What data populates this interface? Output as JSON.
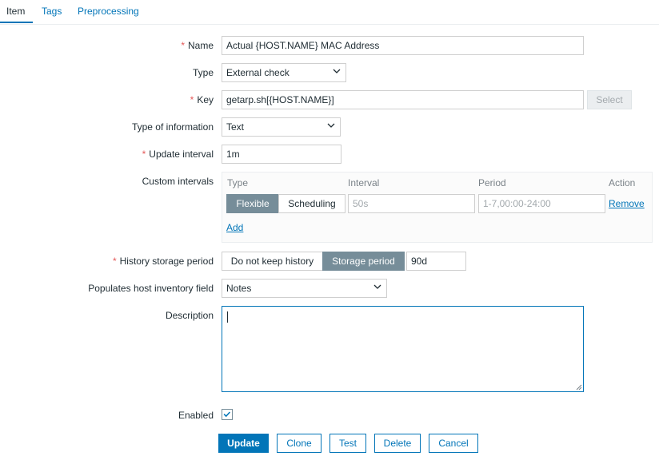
{
  "tabs": [
    {
      "label": "Item",
      "active": true
    },
    {
      "label": "Tags",
      "active": false
    },
    {
      "label": "Preprocessing",
      "active": false
    }
  ],
  "form": {
    "name": {
      "label": "Name",
      "required": true,
      "value": "Actual {HOST.NAME} MAC Address"
    },
    "type": {
      "label": "Type",
      "value": "External check"
    },
    "key": {
      "label": "Key",
      "required": true,
      "value": "getarp.sh[{HOST.NAME}]",
      "select_label": "Select"
    },
    "type_of_information": {
      "label": "Type of information",
      "value": "Text"
    },
    "update_interval": {
      "label": "Update interval",
      "required": true,
      "value": "1m"
    },
    "custom_intervals": {
      "label": "Custom intervals",
      "headers": {
        "type": "Type",
        "interval": "Interval",
        "period": "Period",
        "action": "Action"
      },
      "row": {
        "flexible_label": "Flexible",
        "scheduling_label": "Scheduling",
        "selected": "Flexible",
        "interval_placeholder": "50s",
        "period_placeholder": "1-7,00:00-24:00",
        "remove_label": "Remove"
      },
      "add_label": "Add"
    },
    "history": {
      "label": "History storage period",
      "required": true,
      "options": [
        "Do not keep history",
        "Storage period"
      ],
      "selected": "Storage period",
      "value": "90d"
    },
    "inventory": {
      "label": "Populates host inventory field",
      "value": "Notes"
    },
    "description": {
      "label": "Description",
      "value": ""
    },
    "enabled": {
      "label": "Enabled",
      "checked": true
    }
  },
  "buttons": {
    "update": "Update",
    "clone": "Clone",
    "test": "Test",
    "delete": "Delete",
    "cancel": "Cancel"
  },
  "colors": {
    "accent": "#0275b8",
    "required": "#e45959",
    "segment_active": "#768d99"
  }
}
